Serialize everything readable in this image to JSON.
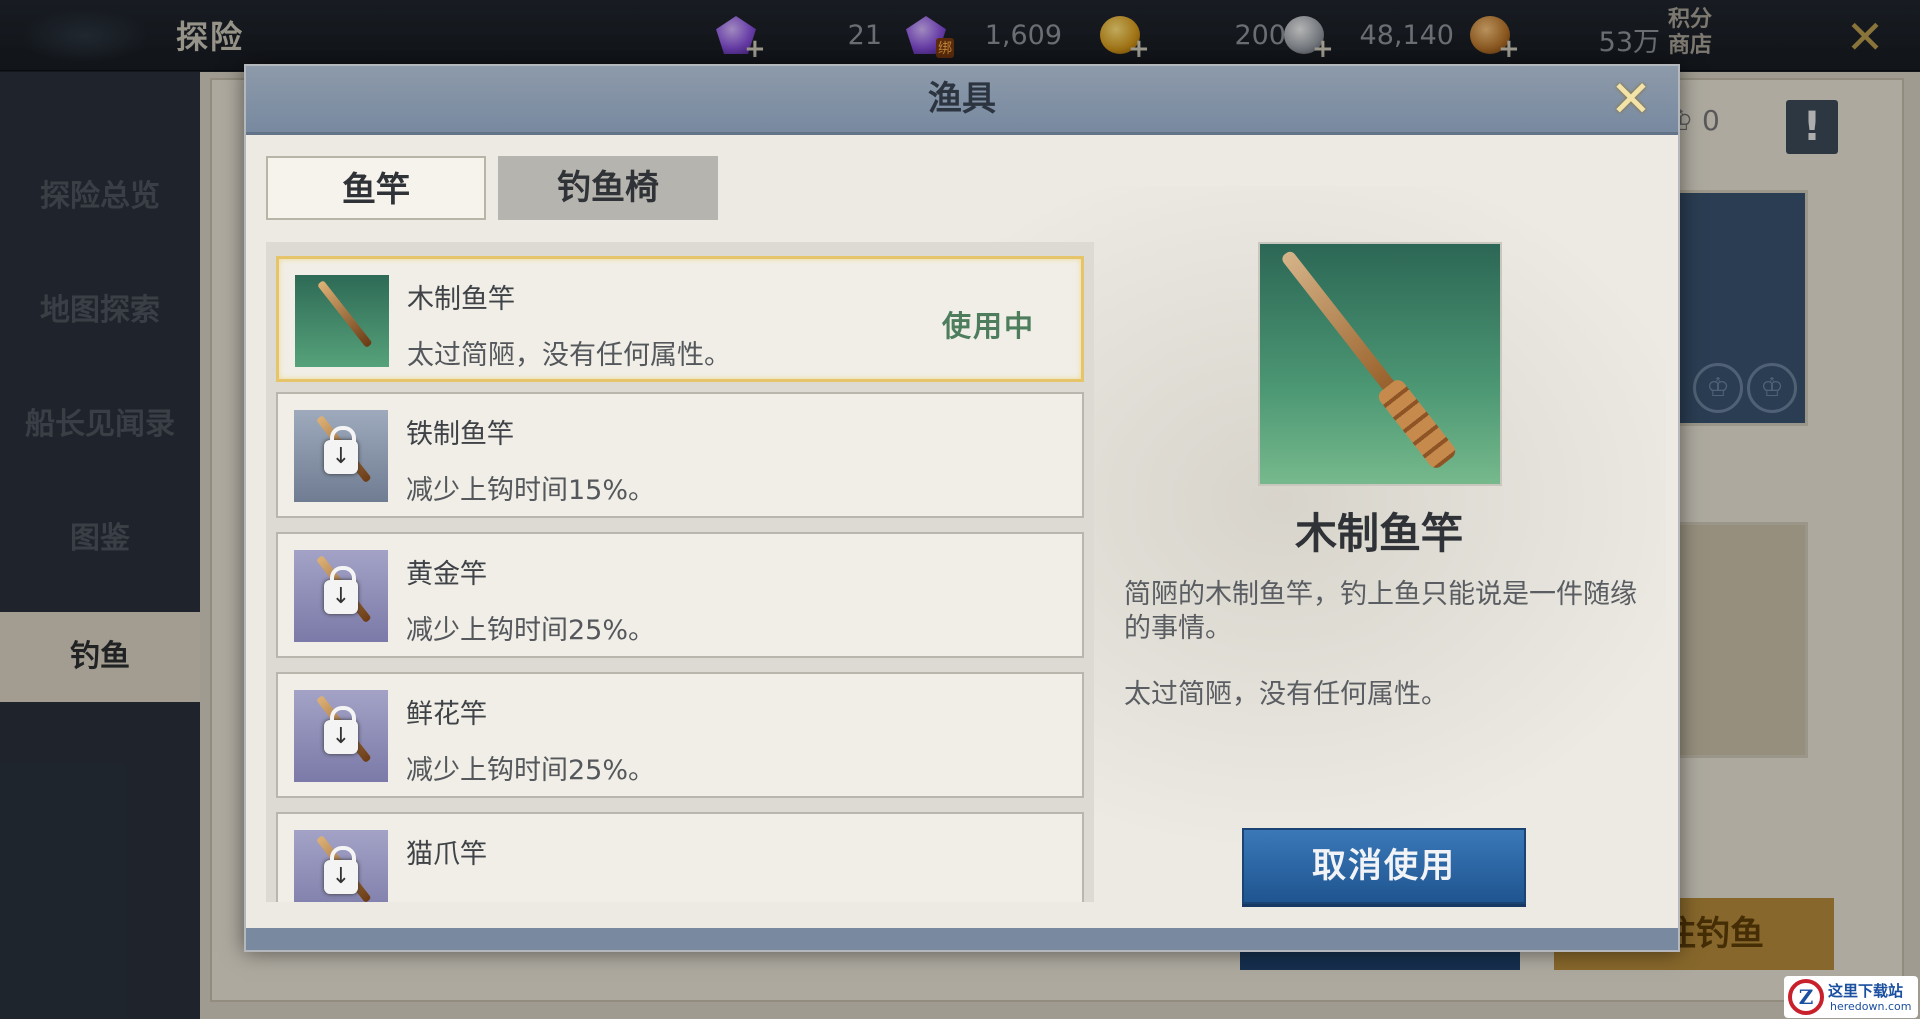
{
  "topbar": {
    "title": "探险",
    "resources": [
      {
        "icon": "purple-gem-icon",
        "value": "21",
        "plus": "+"
      },
      {
        "icon": "bound-purple-gem-icon",
        "value": "1,609",
        "tag": "绑"
      },
      {
        "icon": "gold-coin-icon",
        "value": "200",
        "plus": "+"
      },
      {
        "icon": "silver-coin-icon",
        "value": "48,140",
        "plus": "+"
      },
      {
        "icon": "copper-coin-icon",
        "value": "53万",
        "plus": "+"
      }
    ],
    "shop_label": "积分商店",
    "close_icon": "close-icon"
  },
  "sidebar": {
    "items": [
      {
        "label": "探险总览",
        "active": false
      },
      {
        "label": "地图探索",
        "active": false
      },
      {
        "label": "船长见闻录",
        "active": false
      },
      {
        "label": "图鉴",
        "active": false
      },
      {
        "label": "钓鱼",
        "active": true
      }
    ]
  },
  "background": {
    "hud_count": "0",
    "alert": "!",
    "gold_button_label": "往钓鱼"
  },
  "modal": {
    "title": "渔具",
    "tabs": [
      {
        "label": "鱼竿",
        "active": true
      },
      {
        "label": "钓鱼椅",
        "active": false
      }
    ],
    "list": [
      {
        "name": "木制鱼竿",
        "desc": "太过简陋，没有任何属性。",
        "status": "使用中",
        "locked": false,
        "selected": true
      },
      {
        "name": "铁制鱼竿",
        "desc": "减少上钩时间15%。",
        "status": "",
        "locked": true,
        "selected": false
      },
      {
        "name": "黄金竿",
        "desc": "减少上钩时间25%。",
        "status": "",
        "locked": true,
        "selected": false
      },
      {
        "name": "鲜花竿",
        "desc": "减少上钩时间25%。",
        "status": "",
        "locked": true,
        "selected": false
      },
      {
        "name": "猫爪竿",
        "desc": "",
        "status": "",
        "locked": true,
        "selected": false
      }
    ],
    "detail": {
      "name": "木制鱼竿",
      "description": "简陋的木制鱼竿，钓上鱼只能说是一件随缘的事情。",
      "effect": "太过简陋，没有任何属性。",
      "button_label": "取消使用"
    }
  },
  "watermark": {
    "logo_letter": "Z",
    "text": "这里下载站",
    "sub": "heredown.com"
  },
  "colors": {
    "accent_blue": "#1f5590",
    "selected_border": "#e5c46a",
    "in_use_green": "#4d7d5c"
  }
}
